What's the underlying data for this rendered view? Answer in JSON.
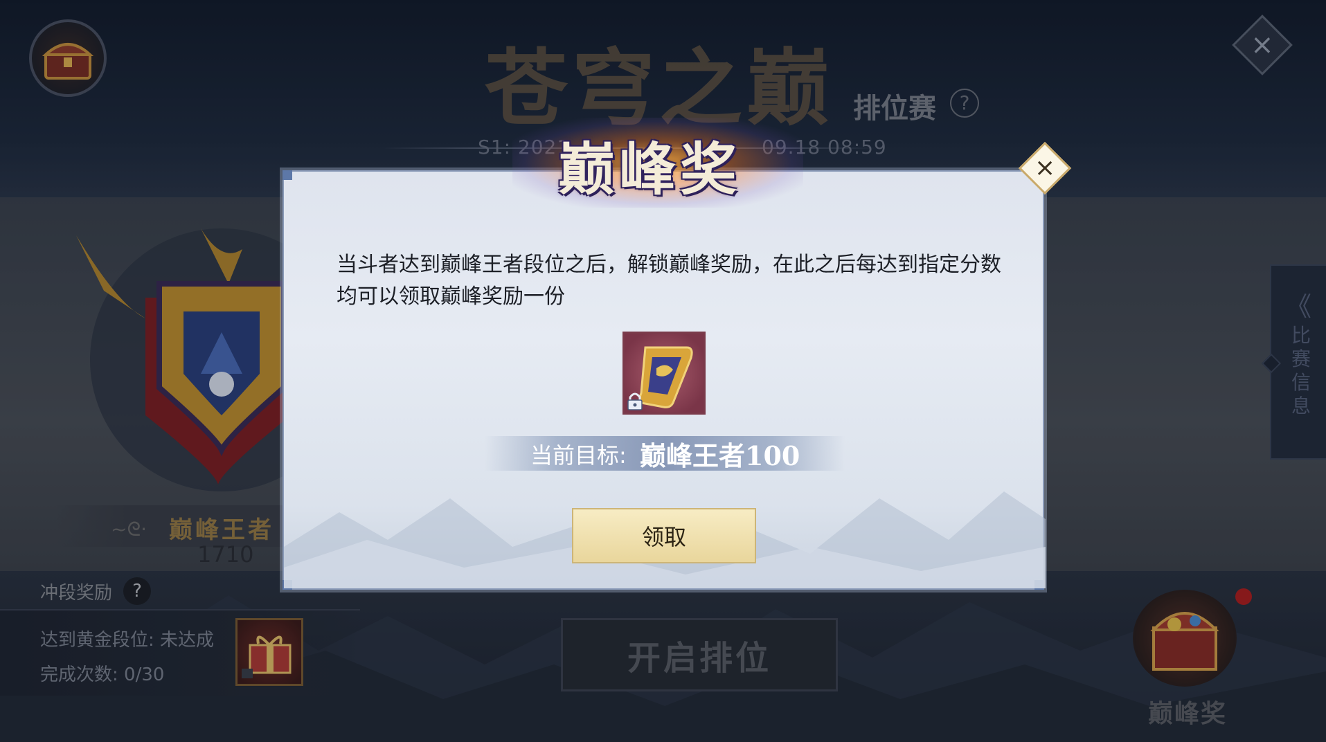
{
  "header": {
    "title": "苍穹之巅",
    "subtitle": "排位赛",
    "season": "S1: 2021",
    "season_end": "09.18 08:59"
  },
  "left_panel": {
    "rank_name": "巅峰王者",
    "rank_score": "1710",
    "rush_reward_label": "冲段奖励",
    "rush_goal": "达到黄金段位:  未达成",
    "rush_progress": "完成次数: 0/30"
  },
  "start_button": {
    "label": "开启排位"
  },
  "side_tab": {
    "label_chars": [
      "比",
      "赛",
      "信",
      "息"
    ]
  },
  "bottom_right": {
    "label": "巅峰奖"
  },
  "modal": {
    "title": "巅峰奖",
    "description": "当斗者达到巅峰王者段位之后，解锁巅峰奖励，在此之后每达到指定分数均可以领取巅峰奖励一份",
    "target_label": "当前目标:",
    "target_value": "巅峰王者100",
    "claim_label": "领取"
  },
  "icons": {
    "close": "×",
    "help": "?",
    "arrow_left": "《"
  },
  "colors": {
    "modal_bg": "#e2e7f0",
    "claim_btn": "#efe0ae",
    "rank_gold": "#9a7d45",
    "notification": "#b01e1e"
  }
}
